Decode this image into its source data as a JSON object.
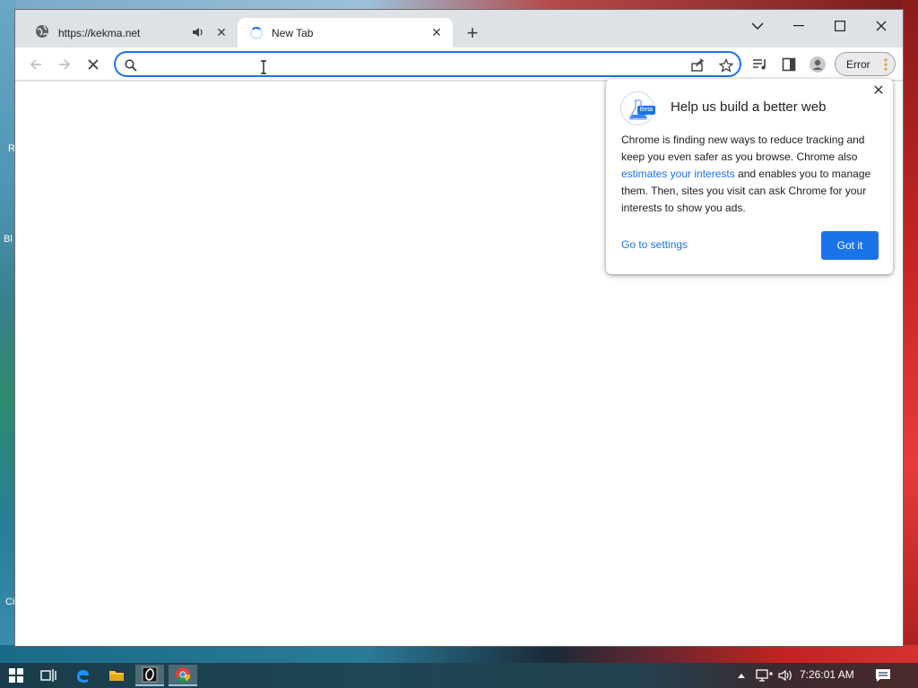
{
  "desktop": {
    "left_letters": [
      "R",
      "Bl",
      "Ci"
    ]
  },
  "tabs": [
    {
      "title": "https://kekma.net",
      "state": "inactive",
      "icon": "globe-icon",
      "audio": true
    },
    {
      "title": "New Tab",
      "state": "active-loading",
      "icon": "loading-spinner"
    }
  ],
  "omnibox": {
    "value": "",
    "placeholder": ""
  },
  "profile": {
    "status_label": "Error"
  },
  "popup": {
    "title": "Help us build a better web",
    "beta_badge": "Beta",
    "body_before_link": "Chrome is finding new ways to reduce tracking and keep you even safer as you browse. Chrome also ",
    "body_link": "estimates your interests",
    "body_after_link": " and enables you to manage them. Then, sites you visit can ask Chrome for your interests to show you ads.",
    "settings_link": "Go to settings",
    "confirm_button": "Got it"
  },
  "taskbar": {
    "clock": "7:26:01 AM"
  },
  "colors": {
    "accent": "#1a73e8",
    "tabstrip": "#dee1e6"
  }
}
